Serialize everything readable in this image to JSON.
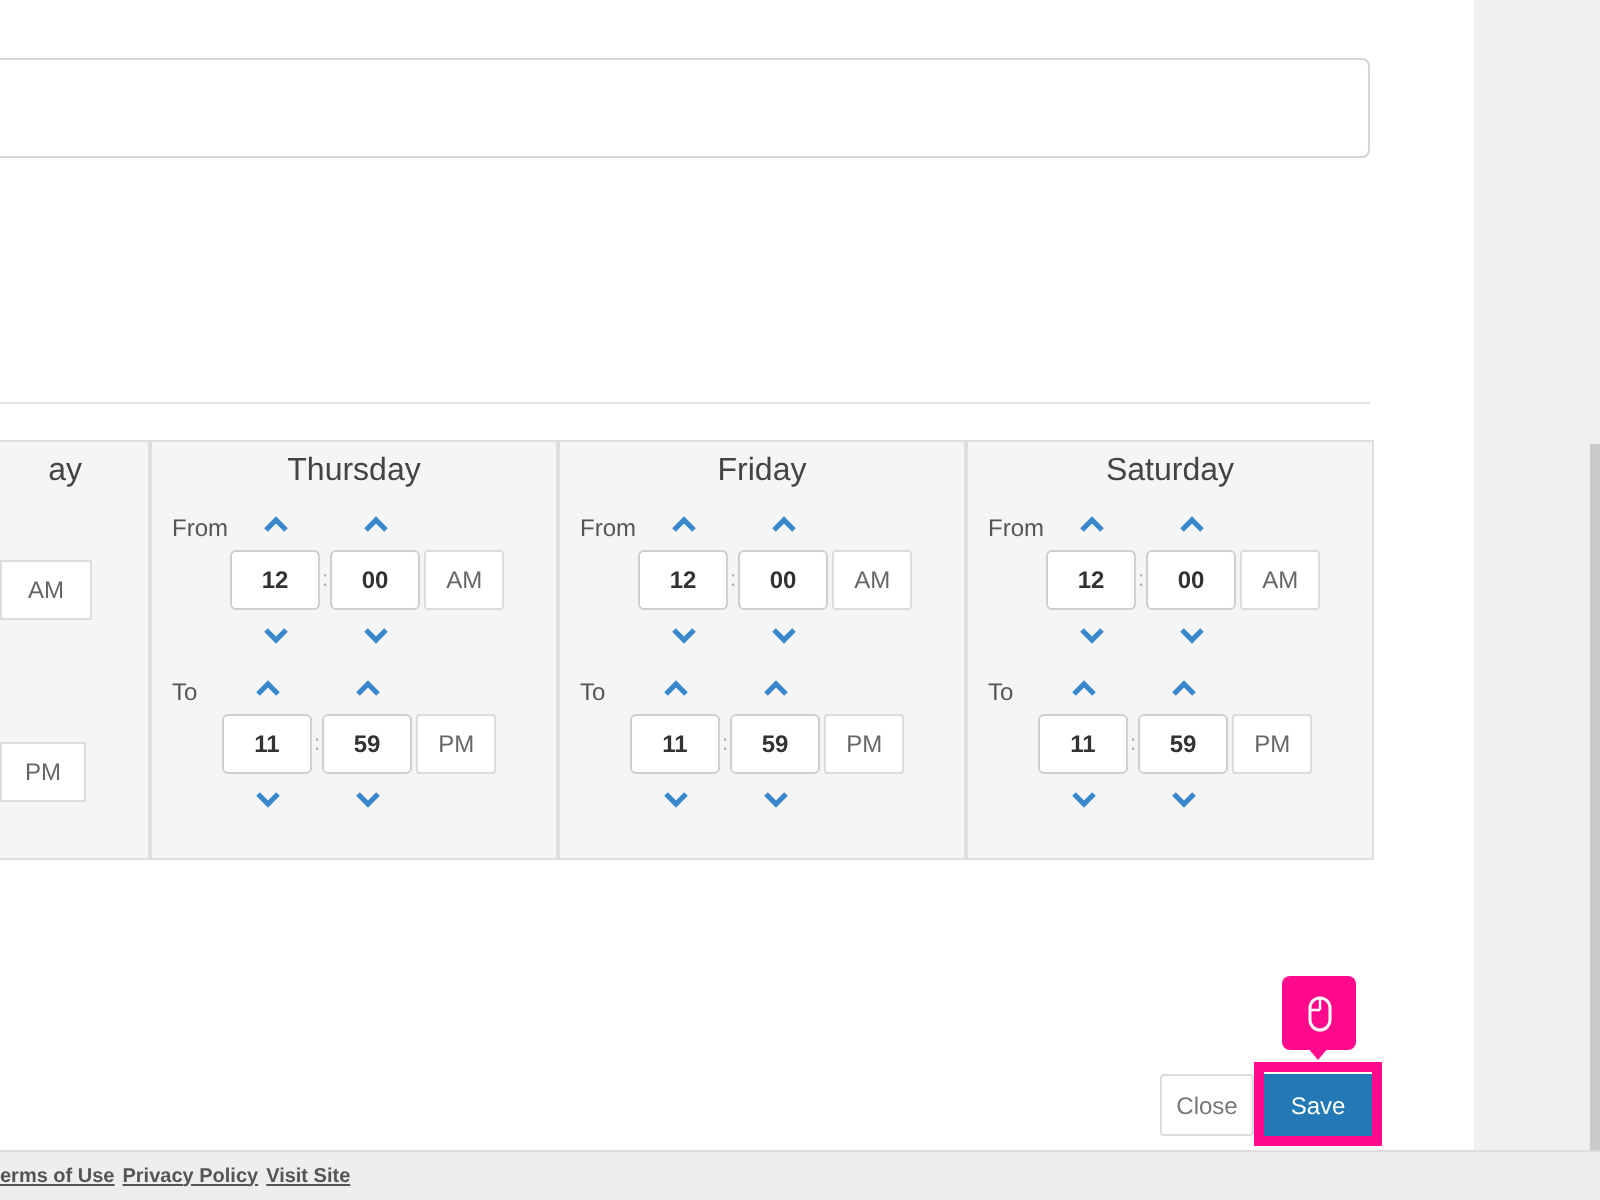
{
  "days": [
    {
      "kind": "partial",
      "name": "ay",
      "from": {
        "meridiem": "AM"
      },
      "to": {
        "meridiem": "PM"
      }
    },
    {
      "kind": "full",
      "name": "Thursday",
      "from": {
        "label": "From",
        "hour": "12",
        "separator": ":",
        "minute": "00",
        "meridiem": "AM"
      },
      "to": {
        "label": "To",
        "hour": "11",
        "separator": ":",
        "minute": "59",
        "meridiem": "PM"
      }
    },
    {
      "kind": "full",
      "name": "Friday",
      "from": {
        "label": "From",
        "hour": "12",
        "separator": ":",
        "minute": "00",
        "meridiem": "AM"
      },
      "to": {
        "label": "To",
        "hour": "11",
        "separator": ":",
        "minute": "59",
        "meridiem": "PM"
      }
    },
    {
      "kind": "full",
      "name": "Saturday",
      "from": {
        "label": "From",
        "hour": "12",
        "separator": ":",
        "minute": "00",
        "meridiem": "AM"
      },
      "to": {
        "label": "To",
        "hour": "11",
        "separator": ":",
        "minute": "59",
        "meridiem": "PM"
      }
    }
  ],
  "buttons": {
    "close": "Close",
    "save": {
      "label": "Save",
      "highlighted": true
    }
  },
  "footer_links": [
    "erms of Use",
    "Privacy Policy",
    "Visit Site"
  ]
}
